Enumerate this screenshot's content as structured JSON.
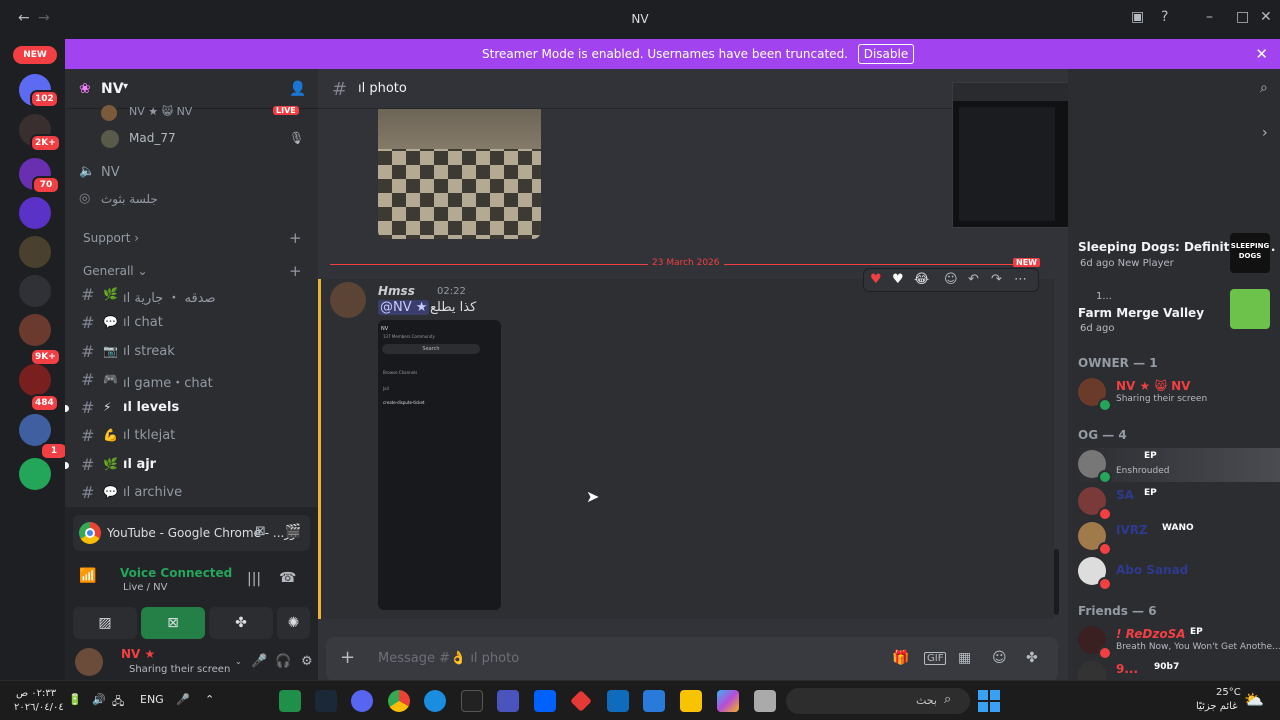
{
  "window": {
    "title": "NV"
  },
  "banner": {
    "message": "Streamer Mode is enabled. Usernames have been truncated.",
    "button": "Disable"
  },
  "servers": {
    "new_label": "NEW",
    "badges": [
      "102",
      "2K+",
      "70",
      "9K+",
      "484",
      "1"
    ]
  },
  "sidebar": {
    "server_name": "NV",
    "live_label": "LIVE",
    "voice_users": [
      {
        "name": "NV ★ 😸 NV"
      },
      {
        "name": "Mad_77"
      }
    ],
    "voice_channels": [
      {
        "label": "NV"
      },
      {
        "label": "جلسة بثوث"
      }
    ],
    "categories": [
      {
        "label": "Support"
      },
      {
        "label": "Generall"
      }
    ],
    "channels": [
      {
        "emoji": "🌿",
        "label": "ıl صدقه ・ جارية",
        "unread": false
      },
      {
        "emoji": "💬",
        "label": "ıl chat",
        "unread": false
      },
      {
        "emoji": "📷",
        "label": "ıl streak",
        "unread": false
      },
      {
        "emoji": "🎮",
        "label": "ıl game・chat",
        "unread": false
      },
      {
        "emoji": "⚡",
        "label": "ıl levels",
        "unread": true
      },
      {
        "emoji": "💪",
        "label": "ıl tklejat",
        "unread": false
      },
      {
        "emoji": "🌿",
        "label": "ıl ajr",
        "unread": true
      },
      {
        "emoji": "💬",
        "label": "ıl archive",
        "unread": false
      }
    ]
  },
  "voice_panel": {
    "share_title": "YouTube - Google Chrome - ...ور",
    "status": "Voice Connected",
    "channel": "Live / NV",
    "user_name": "NV ★",
    "user_status": "Sharing their screen"
  },
  "chat": {
    "channel_name": "ıl photo",
    "date_divider": "23 March 2026",
    "new_label": "NEW",
    "message": {
      "author": "Hmss",
      "time": "02:22",
      "mention": "@NV ★",
      "text": "كذا يطلع"
    },
    "embed": {
      "server": "NV",
      "tabs": "137 Members   Community",
      "search": "Search",
      "browse": "Browse Channels",
      "section": "Jail",
      "channel": "create-dispute-ticket"
    },
    "placeholder": "Message #👌 ıl photo"
  },
  "members": {
    "activities": [
      {
        "title": "Sleeping Dogs: Definitive E...",
        "sub": "6d ago   New Player",
        "logo_text": "SLEEPING DOGS"
      },
      {
        "title": "Farm Merge Valley",
        "sub": "6d ago",
        "pre": "1..."
      }
    ],
    "groups": [
      {
        "label": "OWNER — 1",
        "members": [
          {
            "name": "NV ★ 😸 NV",
            "sub": "Sharing their screen",
            "tag": ""
          }
        ]
      },
      {
        "label": "OG — 4",
        "members": [
          {
            "name": "",
            "sub": "Enshrouded",
            "tag": "EP"
          },
          {
            "name": "SA",
            "sub": "",
            "tag": "EP"
          },
          {
            "name": "IVRZ",
            "sub": "",
            "tag": "WANO"
          },
          {
            "name": "Abo Sanad",
            "sub": "",
            "tag": ""
          }
        ]
      },
      {
        "label": "Friends — 6",
        "members": [
          {
            "name": "! ReDzoSA",
            "sub": "Breath Now, You Won't Get Anothe...",
            "tag": "EP"
          },
          {
            "name": "9...",
            "sub": "",
            "tag": "90b7"
          }
        ]
      }
    ]
  },
  "taskbar": {
    "search_text": "بحث",
    "lang": "ENG",
    "time": "٠٢:٣٣ ص",
    "date": "٢٠٢٦/٠٤/٠٤",
    "weather_temp": "25°C",
    "weather_text": "غائم جزئيًا"
  },
  "colors": {
    "banner": "#a144f0",
    "voice_green": "#23a55a",
    "red": "#f23f43",
    "blurple": "#5865f2"
  }
}
